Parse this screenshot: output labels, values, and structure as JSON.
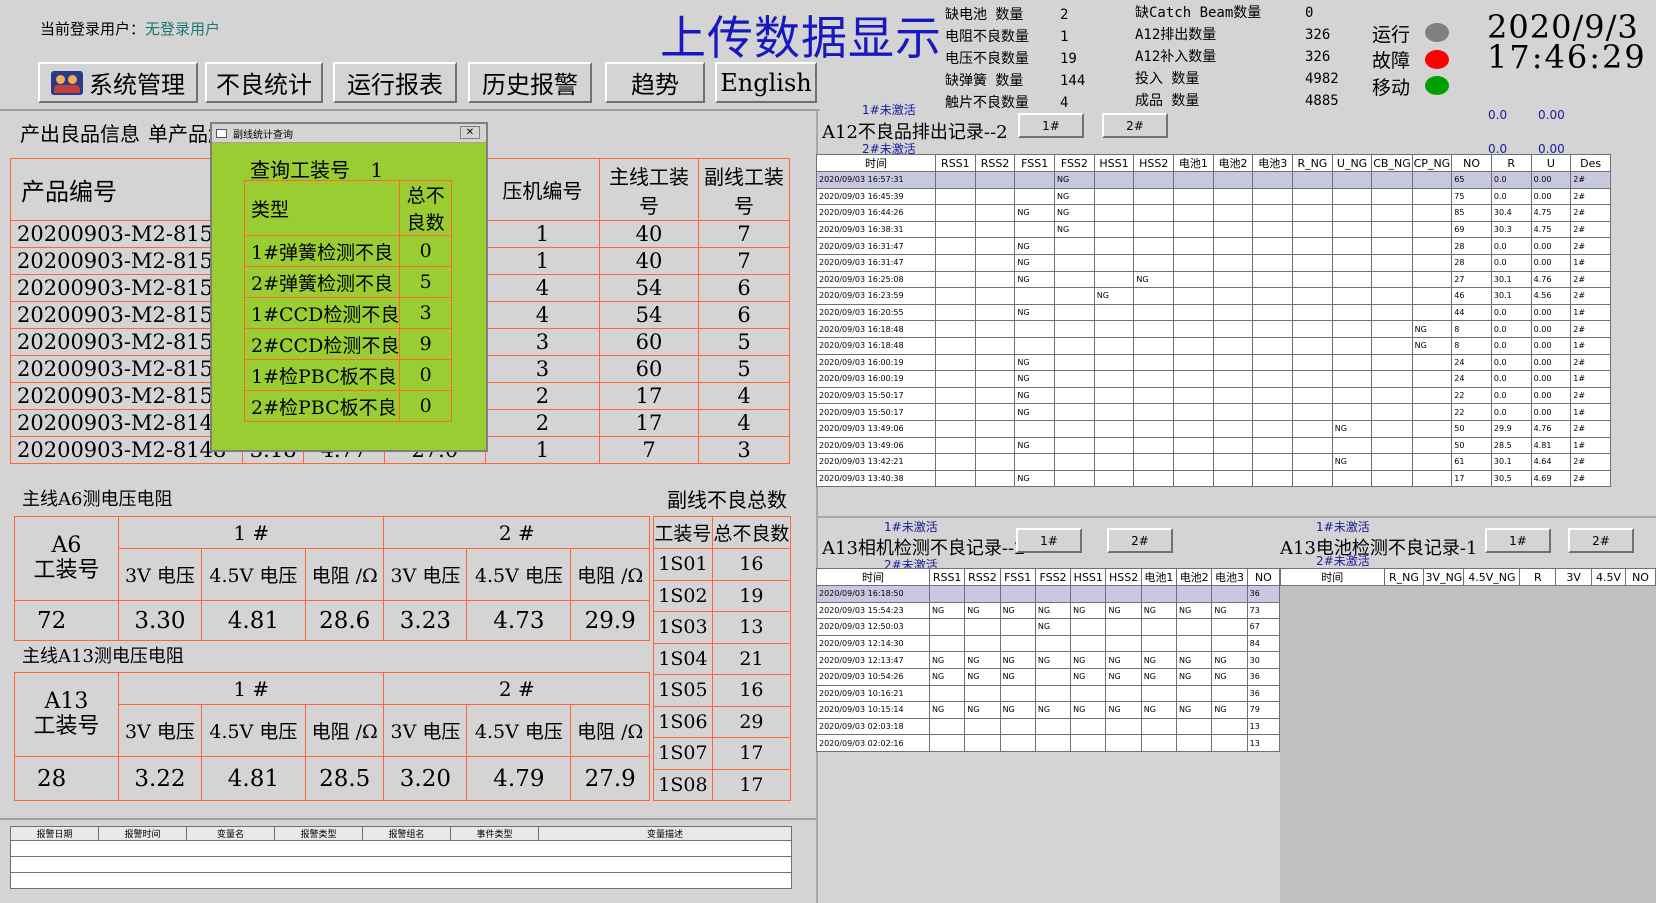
{
  "header": {
    "user_label": "当前登录用户：",
    "user_value": "无登录用户",
    "title": "上传数据显示",
    "date": "2020/9/3",
    "time": "17:46:29"
  },
  "toolbar": {
    "system": "系统管理",
    "defect": "不良统计",
    "report": "运行报表",
    "alarm": "历史报警",
    "trend": "趋势",
    "english": "English"
  },
  "stats_left": [
    {
      "label": "缺电池  数量",
      "value": "2"
    },
    {
      "label": "电阻不良数量",
      "value": "1"
    },
    {
      "label": "电压不良数量",
      "value": "19"
    },
    {
      "label": "缺弹簧 数量",
      "value": "144"
    },
    {
      "label": "触片不良数量",
      "value": "4"
    }
  ],
  "stats_right": [
    {
      "label": "缺Catch Beam数量",
      "value": "0"
    },
    {
      "label": "A12排出数量",
      "value": "326"
    },
    {
      "label": "A12补入数量",
      "value": "326"
    },
    {
      "label": "投入 数量",
      "value": "4982"
    },
    {
      "label": "成品 数量",
      "value": "4885"
    }
  ],
  "status": {
    "run": "运行",
    "fault": "故障",
    "move": "移动",
    "run_color": "#808080",
    "fault_color": "#ff0000",
    "move_color": "#00a000"
  },
  "product": {
    "tab1": "产出良品信息",
    "tab2": "单产品触",
    "headers": {
      "code": "产品编号",
      "press": "压机编号",
      "main": "主线工装号",
      "sub": "副线工装号"
    },
    "rows": [
      {
        "code": "20200903-M2-815",
        "press": "1",
        "main": "40",
        "sub": "7"
      },
      {
        "code": "20200903-M2-815",
        "press": "1",
        "main": "40",
        "sub": "7"
      },
      {
        "code": "20200903-M2-815",
        "press": "4",
        "main": "54",
        "sub": "6"
      },
      {
        "code": "20200903-M2-815",
        "press": "4",
        "main": "54",
        "sub": "6"
      },
      {
        "code": "20200903-M2-815",
        "press": "3",
        "main": "60",
        "sub": "5"
      },
      {
        "code": "20200903-M2-815",
        "press": "3",
        "main": "60",
        "sub": "5"
      },
      {
        "code": "20200903-M2-815",
        "press": "2",
        "main": "17",
        "sub": "4"
      },
      {
        "code": "20200903-M2-814",
        "press": "2",
        "main": "17",
        "sub": "4"
      },
      {
        "code": "20200903-M2-8148",
        "c2": "3.18",
        "c3": "4.77",
        "c4": "27.0",
        "press": "1",
        "main": "7",
        "sub": "3"
      }
    ]
  },
  "popup": {
    "title": "副线统计查询",
    "query_label": "查询工装号",
    "query_value": "1",
    "col_type": "类型",
    "col_count": "总不良数",
    "rows": [
      {
        "type": "1#弹簧检测不良",
        "count": "0"
      },
      {
        "type": "2#弹簧检测不良",
        "count": "5"
      },
      {
        "type": "1#CCD检测不良",
        "count": "3"
      },
      {
        "type": "2#CCD检测不良",
        "count": "9"
      },
      {
        "type": "1#检PBC板不良",
        "count": "0"
      },
      {
        "type": "2#检PBC板不良",
        "count": "0"
      }
    ]
  },
  "a6": {
    "title": "主线A6测电压电阻",
    "fixture_label": "A6\n工装号",
    "fixture": "72",
    "g1": "1  #",
    "g2": "2  #",
    "h3v": "3V 电压",
    "h45v": "4.5V 电压",
    "hr": "电阻 /Ω",
    "v": [
      "3.30",
      "4.81",
      "28.6",
      "3.23",
      "4.73",
      "29.9"
    ]
  },
  "a13": {
    "title": "主线A13测电压电阻",
    "fixture_label": "A13\n工装号",
    "fixture": "28",
    "g1": "1  #",
    "g2": "2  #",
    "h3v": "3V 电压",
    "h45v": "4.5V 电压",
    "hr": "电阻 /Ω",
    "v": [
      "3.22",
      "4.81",
      "28.5",
      "3.20",
      "4.79",
      "27.9"
    ]
  },
  "sub_total": {
    "title": "副线不良总数",
    "h1": "工装号",
    "h2": "总不良数",
    "rows": [
      {
        "id": "1S01",
        "n": "16"
      },
      {
        "id": "1S02",
        "n": "19"
      },
      {
        "id": "1S03",
        "n": "13"
      },
      {
        "id": "1S04",
        "n": "21"
      },
      {
        "id": "1S05",
        "n": "16"
      },
      {
        "id": "1S06",
        "n": "29"
      },
      {
        "id": "1S07",
        "n": "17"
      },
      {
        "id": "1S08",
        "n": "17"
      }
    ]
  },
  "alarm_table": {
    "headers": [
      "报警日期",
      "报警时间",
      "变量名",
      "报警类型",
      "报警组名",
      "事件类型",
      "变量描述"
    ]
  },
  "a12": {
    "title": "A12不良品排出记录--2",
    "inactive1": "1#未激活",
    "inactive2": "2#未激活",
    "btn1": "1#",
    "btn2": "2#",
    "zero1": "0.0",
    "zero2": "0.00",
    "zero3": "0.0",
    "zero4": "0.00",
    "headers": [
      "时间",
      "RSS1",
      "RSS2",
      "FSS1",
      "FSS2",
      "HSS1",
      "HSS2",
      "电池1",
      "电池2",
      "电池3",
      "R_NG",
      "U_NG",
      "CB_NG",
      "CP_NG",
      "NO",
      "R",
      "U",
      "Des"
    ],
    "rows": [
      [
        "2020/09/03 16:57:31",
        "",
        "",
        "",
        "NG",
        "",
        "",
        "",
        "",
        "",
        "",
        "",
        "",
        "",
        "65",
        "0.0",
        "0.00",
        "2#"
      ],
      [
        "2020/09/03 16:45:39",
        "",
        "",
        "",
        "NG",
        "",
        "",
        "",
        "",
        "",
        "",
        "",
        "",
        "",
        "75",
        "0.0",
        "0.00",
        "2#"
      ],
      [
        "2020/09/03 16:44:26",
        "",
        "",
        "NG",
        "NG",
        "",
        "",
        "",
        "",
        "",
        "",
        "",
        "",
        "",
        "85",
        "30.4",
        "4.75",
        "2#"
      ],
      [
        "2020/09/03 16:38:31",
        "",
        "",
        "",
        "NG",
        "",
        "",
        "",
        "",
        "",
        "",
        "",
        "",
        "",
        "69",
        "30.3",
        "4.75",
        "2#"
      ],
      [
        "2020/09/03 16:31:47",
        "",
        "",
        "NG",
        "",
        "",
        "",
        "",
        "",
        "",
        "",
        "",
        "",
        "",
        "28",
        "0.0",
        "0.00",
        "2#"
      ],
      [
        "2020/09/03 16:31:47",
        "",
        "",
        "NG",
        "",
        "",
        "",
        "",
        "",
        "",
        "",
        "",
        "",
        "",
        "28",
        "0.0",
        "0.00",
        "1#"
      ],
      [
        "2020/09/03 16:25:08",
        "",
        "",
        "NG",
        "",
        "",
        "NG",
        "",
        "",
        "",
        "",
        "",
        "",
        "",
        "27",
        "30.1",
        "4.76",
        "2#"
      ],
      [
        "2020/09/03 16:23:59",
        "",
        "",
        "",
        "",
        "NG",
        "",
        "",
        "",
        "",
        "",
        "",
        "",
        "",
        "46",
        "30.1",
        "4.56",
        "2#"
      ],
      [
        "2020/09/03 16:20:55",
        "",
        "",
        "NG",
        "",
        "",
        "",
        "",
        "",
        "",
        "",
        "",
        "",
        "",
        "44",
        "0.0",
        "0.00",
        "1#"
      ],
      [
        "2020/09/03 16:18:48",
        "",
        "",
        "",
        "",
        "",
        "",
        "",
        "",
        "",
        "",
        "",
        "",
        "NG",
        "8",
        "0.0",
        "0.00",
        "2#"
      ],
      [
        "2020/09/03 16:18:48",
        "",
        "",
        "",
        "",
        "",
        "",
        "",
        "",
        "",
        "",
        "",
        "",
        "NG",
        "8",
        "0.0",
        "0.00",
        "1#"
      ],
      [
        "2020/09/03 16:00:19",
        "",
        "",
        "NG",
        "",
        "",
        "",
        "",
        "",
        "",
        "",
        "",
        "",
        "",
        "24",
        "0.0",
        "0.00",
        "2#"
      ],
      [
        "2020/09/03 16:00:19",
        "",
        "",
        "NG",
        "",
        "",
        "",
        "",
        "",
        "",
        "",
        "",
        "",
        "",
        "24",
        "0.0",
        "0.00",
        "1#"
      ],
      [
        "2020/09/03 15:50:17",
        "",
        "",
        "NG",
        "",
        "",
        "",
        "",
        "",
        "",
        "",
        "",
        "",
        "",
        "22",
        "0.0",
        "0.00",
        "2#"
      ],
      [
        "2020/09/03 15:50:17",
        "",
        "",
        "NG",
        "",
        "",
        "",
        "",
        "",
        "",
        "",
        "",
        "",
        "",
        "22",
        "0.0",
        "0.00",
        "1#"
      ],
      [
        "2020/09/03 13:49:06",
        "",
        "",
        "",
        "",
        "",
        "",
        "",
        "",
        "",
        "",
        "NG",
        "",
        "",
        "50",
        "29.9",
        "4.76",
        "2#"
      ],
      [
        "2020/09/03 13:49:06",
        "",
        "",
        "NG",
        "",
        "",
        "",
        "",
        "",
        "",
        "",
        "",
        "",
        "",
        "50",
        "28.5",
        "4.81",
        "1#"
      ],
      [
        "2020/09/03 13:42:21",
        "",
        "",
        "",
        "",
        "",
        "",
        "",
        "",
        "",
        "",
        "NG",
        "",
        "",
        "61",
        "30.1",
        "4.64",
        "2#"
      ],
      [
        "2020/09/03 13:40:38",
        "",
        "",
        "NG",
        "",
        "",
        "",
        "",
        "",
        "",
        "",
        "",
        "",
        "",
        "17",
        "30.5",
        "4.69",
        "2#"
      ]
    ]
  },
  "a13cam": {
    "title": "A13相机检测不良记录--2",
    "inactive1": "1#未激活",
    "inactive2": "2#未激活",
    "btn1": "1#",
    "btn2": "2#",
    "headers": [
      "时间",
      "RSS1",
      "RSS2",
      "FSS1",
      "FSS2",
      "HSS1",
      "HSS2",
      "电池1",
      "电池2",
      "电池3",
      "NO"
    ],
    "rows": [
      [
        "2020/09/03 16:18:50",
        "",
        "",
        "",
        "",
        "",
        "",
        "",
        "",
        "",
        "36"
      ],
      [
        "2020/09/03 15:54:23",
        "NG",
        "NG",
        "NG",
        "NG",
        "NG",
        "NG",
        "NG",
        "NG",
        "NG",
        "73"
      ],
      [
        "2020/09/03 12:50:03",
        "",
        "",
        "",
        "NG",
        "",
        "",
        "",
        "",
        "",
        "67"
      ],
      [
        "2020/09/03 12:14:30",
        "",
        "",
        "",
        "",
        "",
        "",
        "",
        "",
        "",
        "84"
      ],
      [
        "2020/09/03 12:13:47",
        "NG",
        "NG",
        "NG",
        "NG",
        "NG",
        "NG",
        "NG",
        "NG",
        "NG",
        "30"
      ],
      [
        "2020/09/03 10:54:26",
        "NG",
        "NG",
        "NG",
        "",
        "NG",
        "NG",
        "NG",
        "NG",
        "NG",
        "36"
      ],
      [
        "2020/09/03 10:16:21",
        "",
        "",
        "",
        "",
        "",
        "",
        "",
        "",
        "",
        "36"
      ],
      [
        "2020/09/03 10:15:14",
        "NG",
        "NG",
        "NG",
        "NG",
        "NG",
        "NG",
        "NG",
        "NG",
        "NG",
        "79"
      ],
      [
        "2020/09/03 02:03:18",
        "",
        "",
        "",
        "",
        "",
        "",
        "",
        "",
        "",
        "13"
      ],
      [
        "2020/09/03 02:02:16",
        "",
        "",
        "",
        "",
        "",
        "",
        "",
        "",
        "",
        "13"
      ]
    ]
  },
  "a13bat": {
    "title": "A13电池检测不良记录-1",
    "inactive1": "1#未激活",
    "inactive2": "2#未激活",
    "btn1": "1#",
    "btn2": "2#",
    "headers": [
      "时间",
      "R_NG",
      "3V_NG",
      "4.5V_NG",
      "R",
      "3V",
      "4.5V",
      "NO"
    ]
  }
}
